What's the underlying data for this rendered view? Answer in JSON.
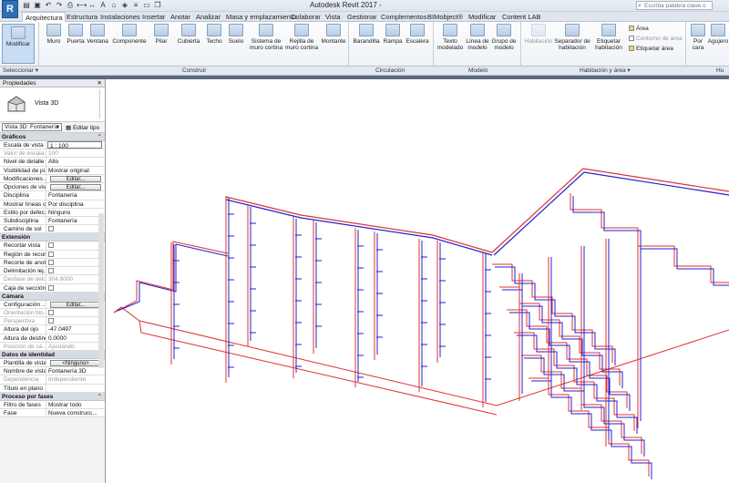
{
  "app": {
    "title": "Autodesk Revit 2017 - ",
    "search_placeholder": "Escriba palabra clave o frase",
    "logo": "R"
  },
  "tabs": [
    "Arquitectura",
    "Estructura",
    "Instalaciones",
    "Insertar",
    "Anotar",
    "Analizar",
    "Masa y emplazamiento",
    "Colaborar",
    "Vista",
    "Gestionar",
    "Complementos",
    "BIMobject®",
    "Modificar",
    "Content LAB"
  ],
  "ribbon": {
    "modify": "Modificar",
    "build": [
      "Muro",
      "Puerta",
      "Ventana",
      "Componente",
      "Pilar",
      "Cubierta",
      "Techo",
      "Suelo",
      "Sistema de muro cortina",
      "Rejilla de muro cortina",
      "Montante"
    ],
    "circulation": [
      "Barandilla",
      "Rampa",
      "Escalera"
    ],
    "model": [
      "Texto modelado",
      "Línea de modelo",
      "Grupo de modelo"
    ],
    "room": {
      "room_disabled": "Habitación",
      "separator": "Separador de habitación",
      "tag": "Etiquetar habitación",
      "area": "Área",
      "area_boundary": "Contorno de área",
      "tag_area": "Etiquetar área"
    },
    "opening": [
      "Por cara",
      "Agujero"
    ],
    "panels": {
      "select": "Seleccionar",
      "build": "Construir",
      "circulation": "Circulación",
      "model": "Modelo",
      "room": "Habitación y área",
      "opening": "Hu"
    }
  },
  "properties": {
    "title": "Propiedades",
    "type_name": "Vista 3D",
    "instance_selector": "Vista 3D: Fontanería",
    "edit_type": "Editar tipo",
    "groups": [
      {
        "name": "Gráficos",
        "rows": [
          {
            "k": "Escala de vista",
            "v": "1 : 100",
            "kind": "input"
          },
          {
            "k": "Valor de escala ...",
            "v": "100",
            "dis": true
          },
          {
            "k": "Nivel de detalle",
            "v": "Alto"
          },
          {
            "k": "Visibilidad de pi...",
            "v": "Mostrar original"
          },
          {
            "k": "Modificaciones ...",
            "v": "Editar...",
            "kind": "button"
          },
          {
            "k": "Opciones de vis...",
            "v": "Editar...",
            "kind": "button"
          },
          {
            "k": "Disciplina",
            "v": "Fontanería"
          },
          {
            "k": "Mostrar líneas o...",
            "v": "Por disciplina"
          },
          {
            "k": "Estilo por defec...",
            "v": "Ninguno"
          },
          {
            "k": "Subdisciplina",
            "v": "Fontanería"
          },
          {
            "k": "Camino de sol",
            "v": "",
            "kind": "check"
          }
        ]
      },
      {
        "name": "Extensión",
        "rows": [
          {
            "k": "Recortar vista",
            "v": "",
            "kind": "check"
          },
          {
            "k": "Región de recor...",
            "v": "",
            "kind": "check"
          },
          {
            "k": "Recorte de anot...",
            "v": "",
            "kind": "check"
          },
          {
            "k": "Delimitación lej...",
            "v": "",
            "kind": "check"
          },
          {
            "k": "Desfase de deli...",
            "v": "304.8000",
            "dis": true
          },
          {
            "k": "Caja de sección",
            "v": "",
            "kind": "check"
          }
        ]
      },
      {
        "name": "Cámara",
        "rows": [
          {
            "k": "Configuración ...",
            "v": "Editar...",
            "kind": "button"
          },
          {
            "k": "Orientación blo...",
            "v": "",
            "kind": "check",
            "dis": true
          },
          {
            "k": "Perspectiva",
            "v": "",
            "kind": "check",
            "dis": true
          },
          {
            "k": "Altura del ojo",
            "v": "-47.0497"
          },
          {
            "k": "Altura de destino",
            "v": "0.0000"
          },
          {
            "k": "Posición de cá...",
            "v": "Ajustando",
            "dis": true
          }
        ]
      },
      {
        "name": "Datos de identidad",
        "rows": [
          {
            "k": "Plantilla de vista",
            "v": "<Ninguno>",
            "kind": "button"
          },
          {
            "k": "Nombre de vista",
            "v": "Fontanería 3D"
          },
          {
            "k": "Dependencia",
            "v": "Independiente",
            "dis": true
          },
          {
            "k": "Título en plano",
            "v": ""
          }
        ]
      },
      {
        "name": "Proceso por fases",
        "rows": [
          {
            "k": "Filtro de fases",
            "v": "Mostrar todo"
          },
          {
            "k": "Fase",
            "v": "Nueva construcc..."
          }
        ]
      }
    ]
  },
  "colors": {
    "accent": "#2e6fb6",
    "pipe_red": "#e03030",
    "pipe_blue": "#2020d0"
  }
}
